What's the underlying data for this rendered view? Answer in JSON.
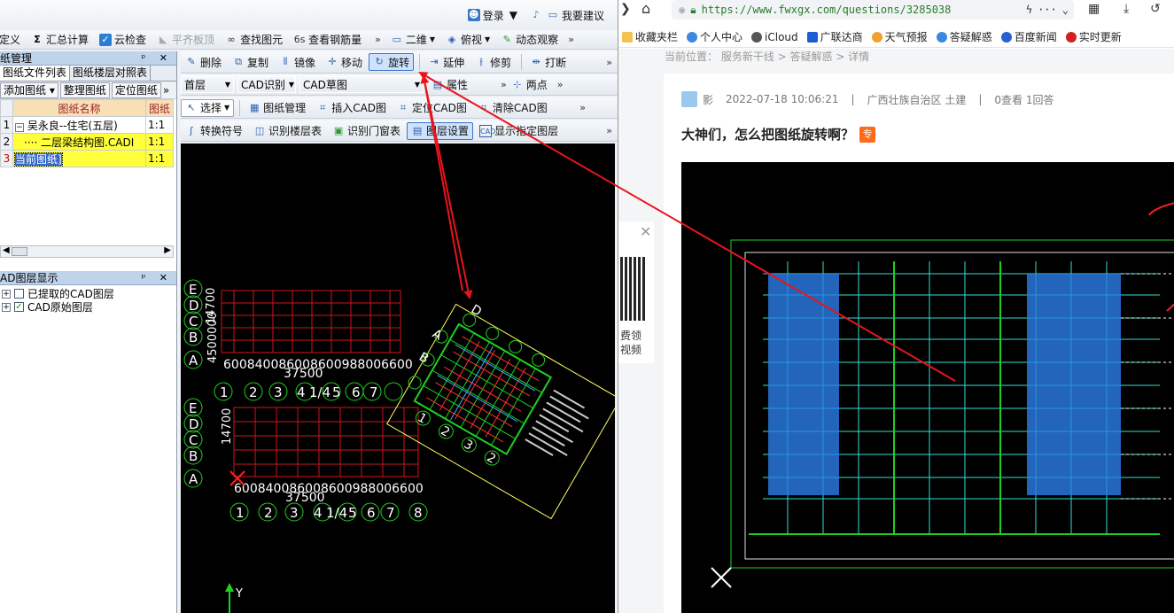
{
  "cad": {
    "title_bar": {
      "login": "登录",
      "suggest": "我要建议"
    },
    "toolbar1": {
      "items": [
        "定义",
        "汇总计算",
        "云检查",
        "平齐板顶",
        "查找图元",
        "查看钢筋量"
      ],
      "view_2d": "二维",
      "view_top": "俯视",
      "dynamic": "动态观察"
    },
    "panel_title": "纸管理",
    "toolbar2": {
      "items": [
        "删除",
        "复制",
        "镜像",
        "移动",
        "旋转",
        "延伸",
        "修剪",
        "打断"
      ]
    },
    "toolbar3": {
      "floor": "首层",
      "cad_recognize": "CAD识别",
      "cad_sketch": "CAD草图",
      "property": "属性",
      "two_point": "两点"
    },
    "toolbar4": {
      "select": "选择",
      "items": [
        "图纸管理",
        "插入CAD图",
        "定位CAD图",
        "清除CAD图"
      ]
    },
    "toolbar5": {
      "items": [
        "转换符号",
        "识别楼层表",
        "识别门窗表",
        "图层设置",
        "显示指定图层"
      ]
    },
    "left_tabs": [
      "图纸文件列表",
      "图纸楼层对照表"
    ],
    "left_tools": [
      "添加图纸",
      "整理图纸",
      "定位图纸"
    ],
    "table": {
      "headers": [
        "图纸名称",
        "图纸"
      ],
      "rows": [
        {
          "n": "1",
          "name": "吴永良--住宅(五层)",
          "scale": "1:1"
        },
        {
          "n": "2",
          "name": "二层梁结构图.CADI",
          "scale": "1:1"
        },
        {
          "n": "3",
          "name": "当前图纸]",
          "scale": "1:1"
        }
      ]
    },
    "layer_panel": {
      "title": "AD图层显示",
      "items": [
        {
          "label": "已提取的CAD图层",
          "checked": false
        },
        {
          "label": "CAD原始图层",
          "checked": true
        }
      ]
    },
    "canvas": {
      "rows_top": [
        "E",
        "D",
        "C",
        "B",
        "A"
      ],
      "cols": [
        "1",
        "2",
        "3",
        "4",
        "1/4",
        "5",
        "6",
        "7"
      ],
      "cols2": [
        "1",
        "2",
        "3",
        "4",
        "1/4",
        "5",
        "6",
        "7",
        "8"
      ],
      "dim_top": "600840086008600988006600",
      "dim_total": "37500",
      "dim_left": "14700",
      "dim_left2": "4500000",
      "dim_left3": "14700",
      "rot_rows": [
        "D",
        "A",
        "B"
      ],
      "rot_cols": [
        "1",
        "2",
        "3",
        "2",
        "1",
        "1"
      ],
      "axis_y": "Y"
    }
  },
  "browser": {
    "url": "https://www.fwxgx.com/questions/3285038",
    "bookmarks": [
      "收藏夹栏",
      "个人中心",
      "iCloud",
      "广联达商",
      "天气预报",
      "答疑解惑",
      "百度新闻",
      "实时更新"
    ],
    "breadcrumb": "当前位置： 服务新干线 > 答疑解惑 > 详情",
    "ad_text": [
      "费领",
      "视频"
    ],
    "meta": {
      "author": "影",
      "time": "2022-07-18 10:06:21",
      "region": "广西壮族自治区  土建",
      "stats": "0查看  1回答"
    },
    "question_title": "大神们，怎么把图纸旋转啊？",
    "badge": "专"
  },
  "colors": {
    "accent": "#3a76c8",
    "arrow": "#e8141c",
    "cad_grid": "#d0141c",
    "cad_green": "#20d020",
    "badge": "#ff6a1a"
  }
}
